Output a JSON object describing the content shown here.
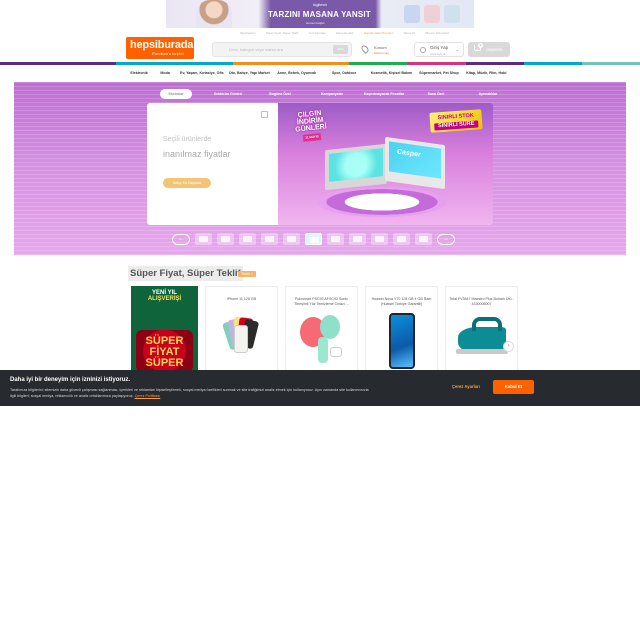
{
  "top_banner": {
    "brand": "logitech",
    "headline": "TARZINI MASANA YANSIT",
    "sub": "Hemen keşfet"
  },
  "utility_bar": [
    "Siparişlerim",
    "Süper Fiyat, Süper Teklif",
    "Yurt dışından",
    "Kampanyalar",
    "Hepsiburada Premium",
    "Satıcı Ol",
    "Müşteri Hizmetleri"
  ],
  "header": {
    "logo_name": "hepsiburada",
    "logo_premium_prefix": "Premium'u",
    "logo_premium_suffix": "keşfet",
    "search_placeholder": "Ürün, kategori veya marka ara",
    "search_button": "ARA",
    "location_title": "Konum",
    "location_sub": "Konum seç",
    "login_title": "Giriş Yap",
    "login_sub": "veya üye ol",
    "cart_label": "Sepetim",
    "cart_count": "0"
  },
  "colors": {
    "brand_orange": "#ff6000",
    "color_bar": [
      "#5a2d82",
      "#5a2d82",
      "#00a9ce",
      "#00a9ce",
      "#f28e1c",
      "#f28e1c",
      "#1bae55",
      "#d63384",
      "#5a2d82",
      "#00a9ce",
      "#6fc6b6"
    ]
  },
  "categories": [
    "Elektronik",
    "Moda",
    "Ev, Yaşam, Kırtasiye, Ofis",
    "Oto, Bahçe, Yapı Market",
    "Anne, Bebek, Oyuncak",
    "Spor, Outdoor",
    "Kozmetik, Kişisel Bakım",
    "Süpermarket, Pet Shop",
    "Kitap, Müzik, Film, Hobi"
  ],
  "hero_tabs": [
    "Ekstralar",
    "Sektörün Günleri",
    "Bugüne Özel",
    "Kampanyalar",
    "Kaçırılmayacak Fırsatlar",
    "Sana Özel",
    "Ayrıcalıklar"
  ],
  "slide": {
    "line1": "Seçili ürünlerde",
    "line2": "inanılmaz fiyatlar",
    "cta": "Satışı Ka Kaçırma",
    "promo_line1": "ÇILGIN",
    "promo_line2": "İNDİRİM",
    "promo_line3": "GÜNLERİ",
    "promo_small": "31 MAYIS",
    "ribbon_line1": "SINIRLI STOK",
    "ribbon_line2": "SINIRLI SÜRE",
    "laptop_brand": "Casper"
  },
  "section": {
    "title": "Süper Fiyat, Süper Teklif",
    "see_all": "Tümü >"
  },
  "promo_card": {
    "line1": "YENİ YIL",
    "line2": "ALIŞVERİŞİ",
    "line3": "SÜPER",
    "line4": "FİYAT",
    "line5": "SÜPER"
  },
  "products": [
    {
      "name": "iPhone 11 128 GB"
    },
    {
      "name": "Polosmart PSC92 AFSC92 Sonic Titreşimli Yüz Temizleme Cihazı ..."
    },
    {
      "name": "Huawei Nova Y70 128 GB 4 GB Ram (Huawei Türkiye Garantili)"
    },
    {
      "name": "Tefal FV3847 Maestro Plus Buharlı Ütü - 4330006007"
    }
  ],
  "cookie": {
    "heading": "Daha iyi bir deneyim için izninizi istiyoruz.",
    "body": "Tarafımıza bilgilerini; sitemizin daha güvenli çalışması sağlanması, içerikleri ve reklamları kişiselleştirmek, sosyal medya özellikleri sunmak ve site trafiğimizi analiz etmek için kullanıyoruz. Aynı zamanda site kullanımınızla ilgili bilgileri; sosyal medya, reklamcılık ve analiz ortaklarımıza paylaşıyoruz.",
    "policy_link": "Çerez Politikası",
    "manage": "Çerez Ayarları",
    "accept": "Kabul Et"
  }
}
